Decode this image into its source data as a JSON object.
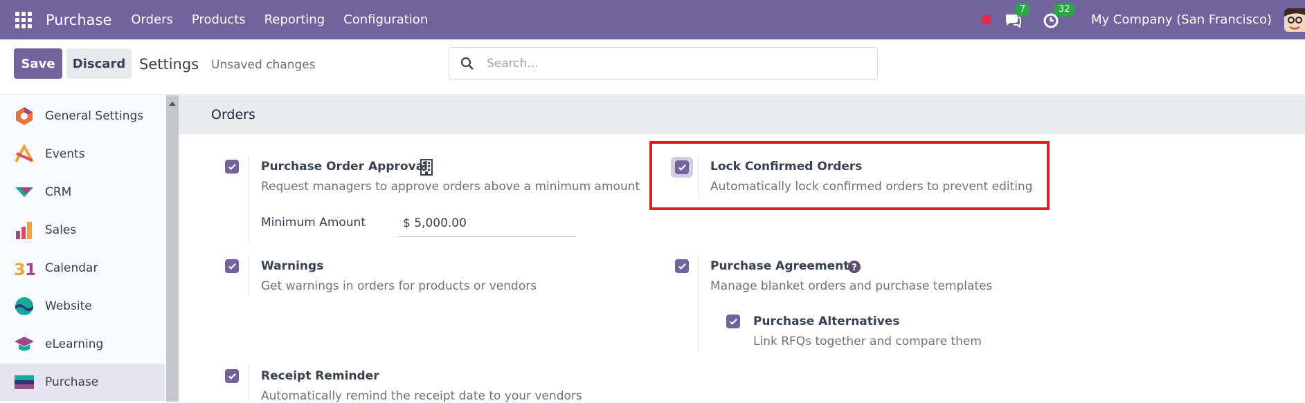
{
  "topbar": {
    "app_name": "Purchase",
    "menu": [
      "Orders",
      "Products",
      "Reporting",
      "Configuration"
    ],
    "chat_badge": "7",
    "activity_badge": "32",
    "company": "My Company (San Francisco)"
  },
  "control": {
    "save_label": "Save",
    "discard_label": "Discard",
    "title": "Settings",
    "status": "Unsaved changes",
    "search_placeholder": "Search..."
  },
  "sidebar": {
    "items": [
      {
        "label": "General Settings",
        "icon": "general-settings-icon"
      },
      {
        "label": "Events",
        "icon": "events-icon"
      },
      {
        "label": "CRM",
        "icon": "crm-icon"
      },
      {
        "label": "Sales",
        "icon": "sales-icon"
      },
      {
        "label": "Calendar",
        "icon": "calendar-icon"
      },
      {
        "label": "Website",
        "icon": "website-icon"
      },
      {
        "label": "eLearning",
        "icon": "elearning-icon"
      },
      {
        "label": "Purchase",
        "icon": "purchase-icon",
        "active": true
      }
    ]
  },
  "section": {
    "title": "Orders",
    "settings": {
      "po_approval": {
        "title": "Purchase Order Approval",
        "desc": "Request managers to approve orders above a minimum amount",
        "checked": true
      },
      "lock_orders": {
        "title": "Lock Confirmed Orders",
        "desc": "Automatically lock confirmed orders to prevent editing",
        "checked": true
      },
      "min_amount": {
        "label": "Minimum Amount",
        "value": "$ 5,000.00"
      },
      "warnings": {
        "title": "Warnings",
        "desc": "Get warnings in orders for products or vendors",
        "checked": true
      },
      "agreements": {
        "title": "Purchase Agreements",
        "desc": "Manage blanket orders and purchase templates",
        "checked": true
      },
      "alternatives": {
        "title": "Purchase Alternatives",
        "desc": "Link RFQs together and compare them",
        "checked": true
      },
      "receipt_reminder": {
        "title": "Receipt Reminder",
        "desc": "Automatically remind the receipt date to your vendors",
        "checked": true
      }
    }
  },
  "colors": {
    "brand": "#71639e",
    "highlight": "#e01b24",
    "badge": "#27a745"
  }
}
